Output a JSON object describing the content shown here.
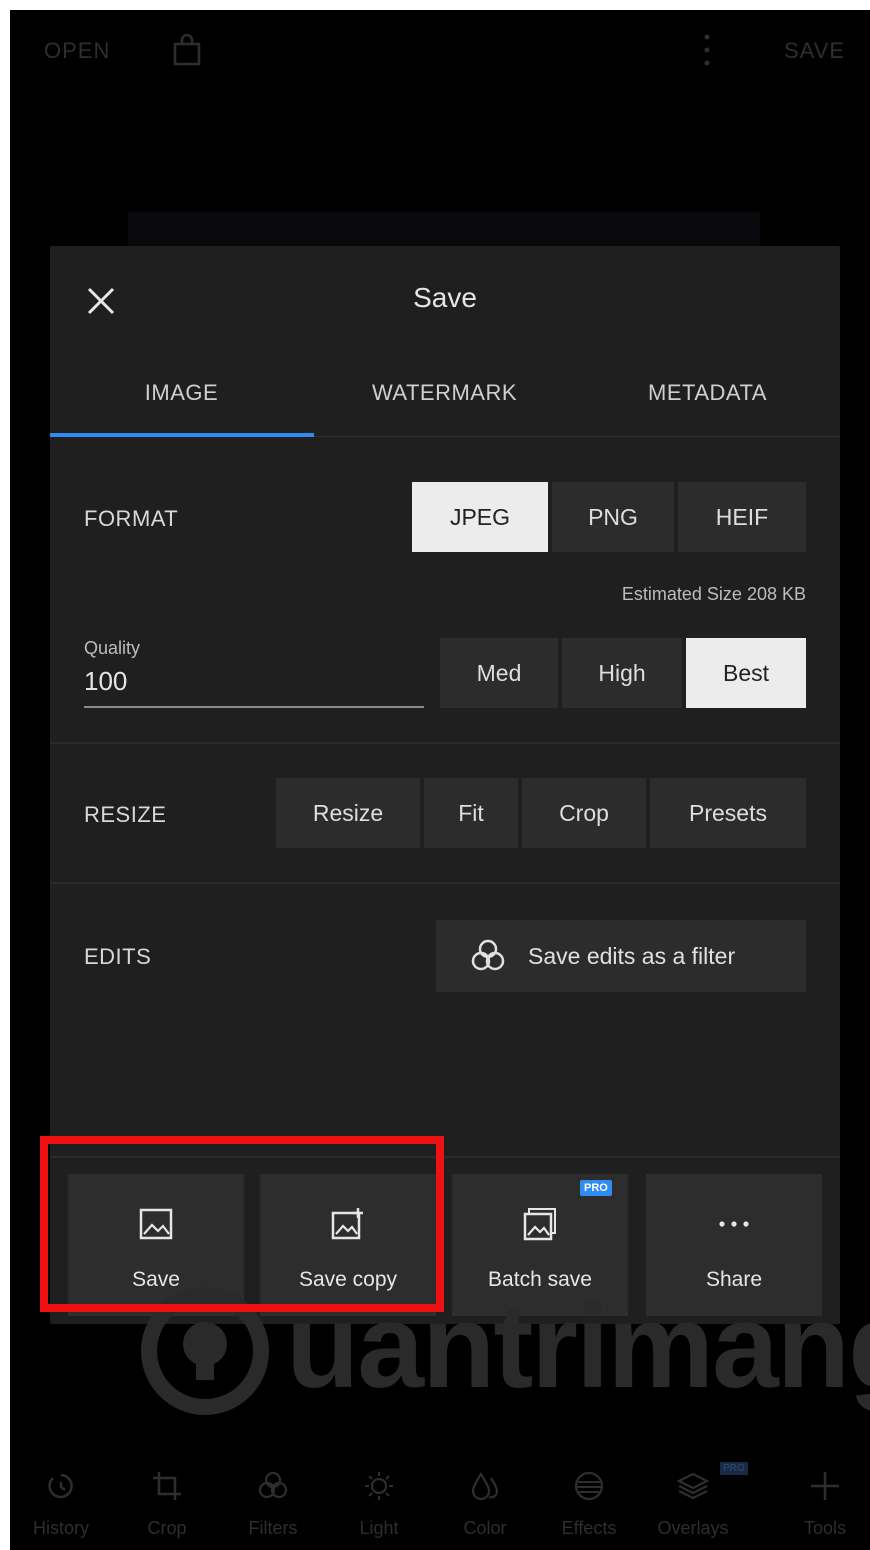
{
  "topbar": {
    "open_label": "OPEN",
    "save_label": "SAVE",
    "icons": [
      "bag-icon",
      "more-vertical-icon"
    ]
  },
  "sheet": {
    "title": "Save",
    "tabs": [
      {
        "label": "IMAGE",
        "active": true
      },
      {
        "label": "WATERMARK"
      },
      {
        "label": "METADATA"
      }
    ],
    "format": {
      "label": "FORMAT",
      "options": [
        "JPEG",
        "PNG",
        "HEIF"
      ],
      "selected": "JPEG"
    },
    "estimated_size": "Estimated Size 208 KB",
    "quality": {
      "label": "Quality",
      "value": "100",
      "options": [
        "Med",
        "High",
        "Best"
      ],
      "selected": "Best"
    },
    "resize": {
      "label": "RESIZE",
      "options": [
        "Resize",
        "Fit",
        "Crop",
        "Presets"
      ]
    },
    "edits": {
      "label": "EDITS",
      "button_label": "Save edits as a filter"
    },
    "actions": [
      {
        "label": "Save",
        "icon": "image-icon"
      },
      {
        "label": "Save copy",
        "icon": "image-copy-icon"
      },
      {
        "label": "Batch save",
        "icon": "batch-image-icon",
        "badge": "PRO"
      },
      {
        "label": "Share",
        "icon": "more-horizontal-icon"
      }
    ]
  },
  "watermark": {
    "text": "uantrimang"
  },
  "toolbar": {
    "items": [
      {
        "label": "History",
        "icon": "history-icon"
      },
      {
        "label": "Crop",
        "icon": "crop-icon"
      },
      {
        "label": "Filters",
        "icon": "filters-icon"
      },
      {
        "label": "Light",
        "icon": "light-icon"
      },
      {
        "label": "Color",
        "icon": "color-icon"
      },
      {
        "label": "Effects",
        "icon": "effects-icon"
      },
      {
        "label": "Overlays",
        "icon": "overlays-icon",
        "badge": "PRO"
      },
      {
        "label": "Tools",
        "icon": "plus-icon"
      }
    ]
  },
  "colors": {
    "accent": "#2f8cf0",
    "highlight": "#ee1111",
    "sheet": "#1f1f1f"
  }
}
